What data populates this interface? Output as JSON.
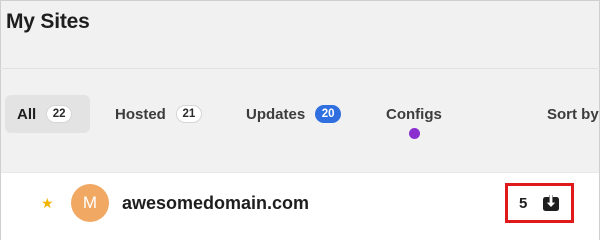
{
  "header": {
    "title": "My Sites"
  },
  "tabs": [
    {
      "label": "All",
      "count": "22",
      "active": true
    },
    {
      "label": "Hosted",
      "count": "21"
    },
    {
      "label": "Updates",
      "count": "20"
    },
    {
      "label": "Configs"
    },
    {
      "label": "Sort by"
    }
  ],
  "site": {
    "avatar_letter": "M",
    "name": "awesomedomain.com",
    "update_count": "5",
    "icons": {
      "favorite": "star-icon",
      "updates": "download-icon"
    }
  },
  "colors": {
    "updates_badge": "#2f6fe0",
    "configs_indicator": "#8a2ed0",
    "avatar": "#f0a863",
    "star": "#f2b400",
    "highlight_box": "#e01a1a"
  }
}
